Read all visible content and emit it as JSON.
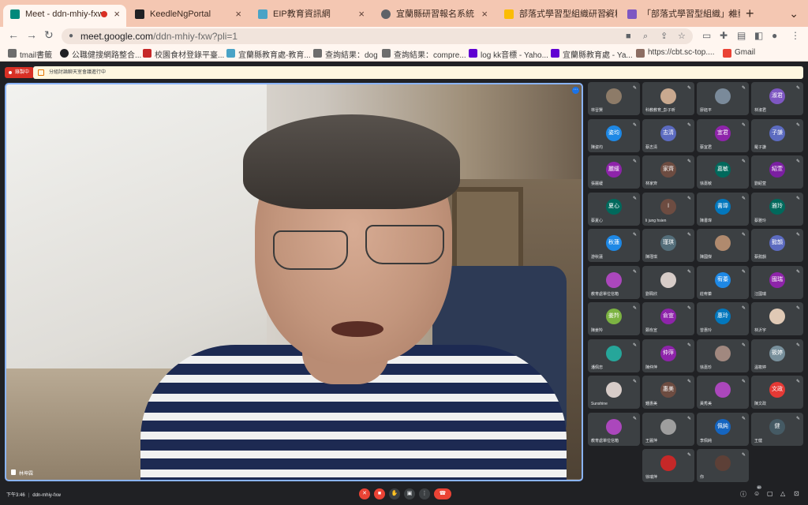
{
  "browser": {
    "tabs": [
      {
        "title": "Meet - ddn-mhiy-fxw",
        "color": "#00897b",
        "active": true,
        "recording": true
      },
      {
        "title": "KeedleNgPortal",
        "color": "#202124"
      },
      {
        "title": "EIP教育資訊網",
        "color": "#4aa3c6"
      },
      {
        "title": "宜蘭縣研習報名系統",
        "color": "#5f6368"
      },
      {
        "title": "部落式學習型組織研習資料",
        "color": "#fbbc04"
      },
      {
        "title": "「部落式學習型組織」推動計",
        "color": "#7e57c2"
      }
    ],
    "newtab": "+",
    "url": {
      "host": "meet.google.com",
      "path": "/ddn-mhiy-fxw?pli=1"
    },
    "bookmarks": [
      {
        "label": "tmail書籤",
        "color": "#6d6d6d"
      },
      {
        "label": "公職健搜網路整合...",
        "color": "#202124"
      },
      {
        "label": "校園食材登錄平臺...",
        "color": "#c62828"
      },
      {
        "label": "宜蘭縣教育處-教育...",
        "color": "#4aa3c6"
      },
      {
        "label": "查詢結果：dog",
        "color": "#6d6d6d"
      },
      {
        "label": "查詢結果：compre...",
        "color": "#6d6d6d"
      },
      {
        "label": "log kk音標 - Yaho...",
        "color": "#6001d2"
      },
      {
        "label": "宜蘭縣教育處 - Ya...",
        "color": "#6001d2"
      },
      {
        "label": "https://cbt.sc-top....",
        "color": "#8d6e63"
      },
      {
        "label": "Gmail",
        "color": "#ea4335"
      }
    ]
  },
  "meet": {
    "recording_label": "錄製中",
    "notice": "分組討論聊天室會議進行中",
    "speaker_name": "林坤霖",
    "more_icon": "⋯",
    "time": "下午3:46",
    "meeting_code": "ddn-mhiy-fxw",
    "people_count": "60",
    "participants": [
      {
        "name": "林晉賢",
        "avatar": "",
        "color": "#8d7b68",
        "photo": true
      },
      {
        "name": "科教教育_彭子昕",
        "avatar": "",
        "color": "#c9a98f",
        "photo": true
      },
      {
        "name": "廖鈺平",
        "avatar": "",
        "color": "#7a8a9a",
        "photo": true
      },
      {
        "name": "林淑君",
        "avatar": "淑君",
        "color": "#7e57c2"
      },
      {
        "name": "陳姿均",
        "avatar": "姿均",
        "color": "#1e88e5"
      },
      {
        "name": "蔡志清",
        "avatar": "志清",
        "color": "#5c6bc0"
      },
      {
        "name": "蔡宜君",
        "avatar": "宜君",
        "color": "#8e24aa"
      },
      {
        "name": "羅子謙",
        "avatar": "子謙",
        "color": "#5c6bc0"
      },
      {
        "name": "張麗緩",
        "avatar": "麗緩",
        "color": "#8e24aa"
      },
      {
        "name": "林家齊",
        "avatar": "家齊",
        "color": "#6d4c41"
      },
      {
        "name": "徐嘉敏",
        "avatar": "嘉敏",
        "color": "#00695c"
      },
      {
        "name": "劉紹萱",
        "avatar": "紹萱",
        "color": "#7b1fa2"
      },
      {
        "name": "蔡夏心",
        "avatar": "夏心",
        "color": "#00695c"
      },
      {
        "name": "li jung hsien",
        "avatar": "l",
        "color": "#6d4c41"
      },
      {
        "name": "陳書瑋",
        "avatar": "書瑋",
        "color": "#0277bd"
      },
      {
        "name": "蔡雅玲",
        "avatar": "雅玲",
        "color": "#00695c"
      },
      {
        "name": "游秋蓮",
        "avatar": "秋蓮",
        "color": "#1e88e5"
      },
      {
        "name": "陳瑾琪",
        "avatar": "瑾琪",
        "color": "#546e7a"
      },
      {
        "name": "陳國傑",
        "avatar": "",
        "color": "#b08a6e",
        "photo": true
      },
      {
        "name": "蔡懿韻",
        "avatar": "懿韻",
        "color": "#5c6bc0"
      },
      {
        "name": "教育處單位信箱",
        "avatar": "",
        "color": "#ab47bc",
        "photo": true
      },
      {
        "name": "劉珮欣",
        "avatar": "",
        "color": "#d7ccc8",
        "photo": true
      },
      {
        "name": "莊宥蓁",
        "avatar": "宥蓁",
        "color": "#1e88e5"
      },
      {
        "name": "汪國瑞",
        "avatar": "國瑞",
        "color": "#8e24aa"
      },
      {
        "name": "陳姜羚",
        "avatar": "姜羚",
        "color": "#7cb342"
      },
      {
        "name": "鄭俞宣",
        "avatar": "俞宣",
        "color": "#8e24aa"
      },
      {
        "name": "曾惠玲",
        "avatar": "惠玲",
        "color": "#0277bd"
      },
      {
        "name": "林沂宇",
        "avatar": "",
        "color": "#e0c9b5",
        "photo": true
      },
      {
        "name": "潘佩忠",
        "avatar": "",
        "color": "#26a69a",
        "photo": true
      },
      {
        "name": "陳仲萍",
        "avatar": "仲萍",
        "color": "#8e24aa"
      },
      {
        "name": "徐嘉珍",
        "avatar": "",
        "color": "#a1887f",
        "photo": true
      },
      {
        "name": "溫筱婷",
        "avatar": "筱婷",
        "color": "#78909c"
      },
      {
        "name": "Sunshine",
        "avatar": "",
        "color": "#d7ccc8",
        "photo": true
      },
      {
        "name": "鍾惠美",
        "avatar": "惠美",
        "color": "#6d4c41"
      },
      {
        "name": "黃秀美",
        "avatar": "",
        "color": "#ab47bc",
        "photo": true
      },
      {
        "name": "陳文政",
        "avatar": "文政",
        "color": "#e53935"
      },
      {
        "name": "教育處單位信箱",
        "avatar": "",
        "color": "#ab47bc",
        "photo": true
      },
      {
        "name": "王麗萍",
        "avatar": "",
        "color": "#9e9e9e",
        "photo": true
      },
      {
        "name": "李佩純",
        "avatar": "佩純",
        "color": "#1565c0"
      },
      {
        "name": "王健",
        "avatar": "健",
        "color": "#455a64"
      },
      {
        "name": "徐瑞萍",
        "avatar": "",
        "color": "#c62828",
        "photo": true
      },
      {
        "name": "你",
        "avatar": "",
        "color": "#5d4037",
        "photo": true
      }
    ]
  }
}
